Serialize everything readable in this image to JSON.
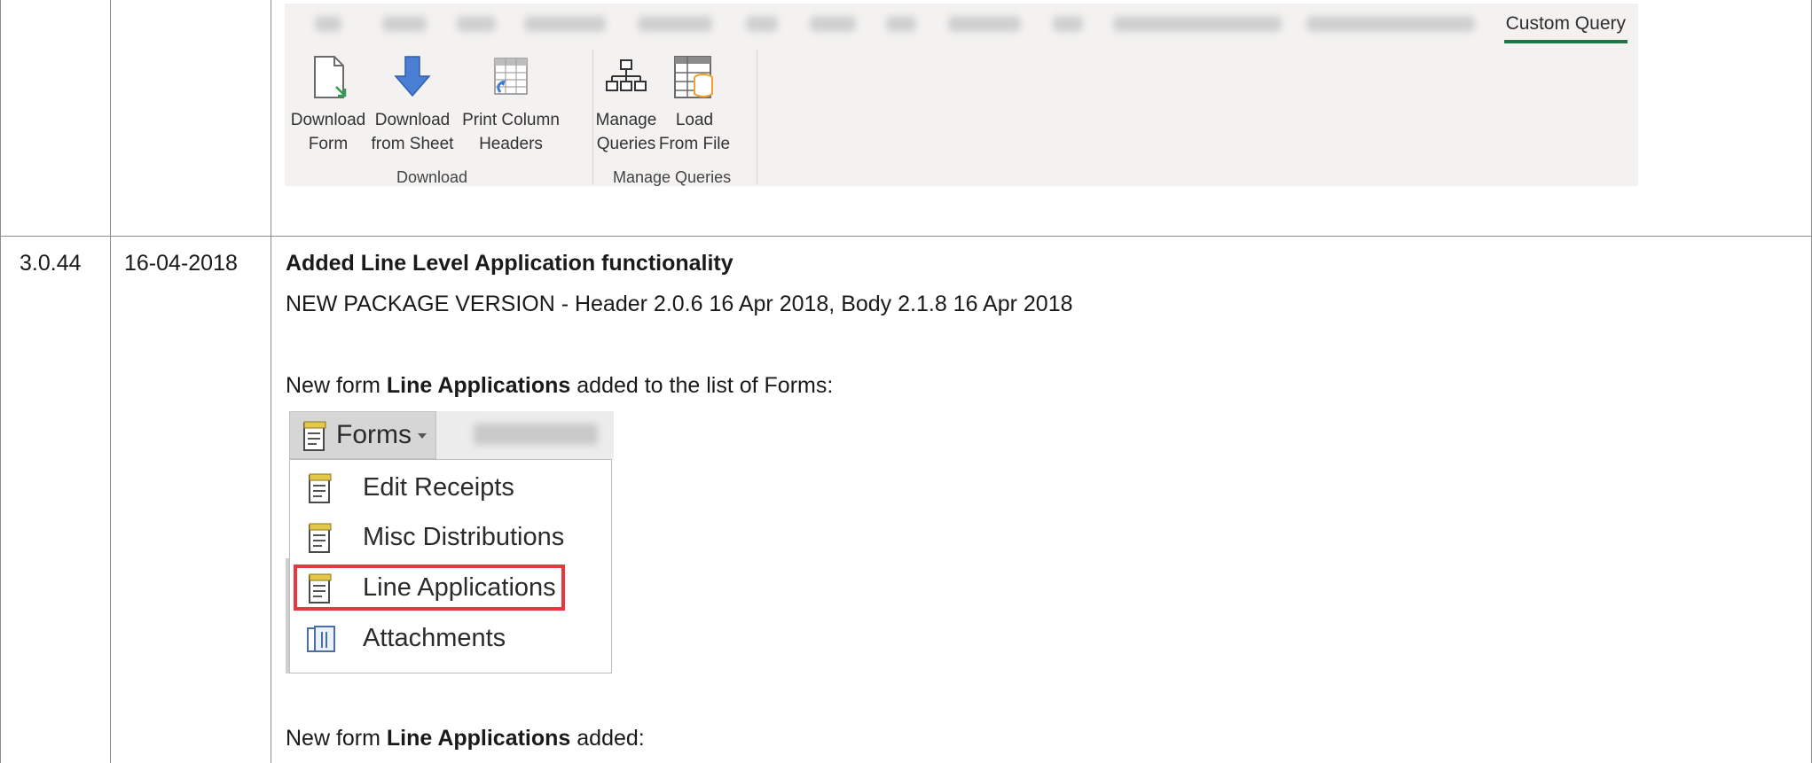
{
  "ribbon": {
    "active_tab": "Custom Query",
    "buttons": [
      {
        "line1": "Download",
        "line2": "Form",
        "icon": "document-arrow-icon"
      },
      {
        "line1": "Download",
        "line2": "from Sheet",
        "icon": "down-arrow-icon"
      },
      {
        "line1": "Print Column",
        "line2": "Headers",
        "icon": "table-headers-icon"
      },
      {
        "line1": "Manage",
        "line2": "Queries",
        "icon": "hierarchy-icon"
      },
      {
        "line1": "Load",
        "line2": "From File",
        "icon": "table-database-icon"
      }
    ],
    "groups": [
      "Download",
      "Manage Queries"
    ]
  },
  "row": {
    "version": "3.0.44",
    "date": "16-04-2018",
    "heading": "Added Line Level Application functionality",
    "package_line": "NEW PACKAGE VERSION - Header 2.0.6 16 Apr 2018, Body 2.1.8 16 Apr 2018",
    "para1_prefix": "New form ",
    "para1_bold": "Line Applications",
    "para1_suffix": " added to the list of Forms:",
    "para2_prefix": "New form ",
    "para2_bold": "Line Applications",
    "para2_suffix": " added:"
  },
  "forms_menu": {
    "button_label": "Forms",
    "items": [
      "Edit Receipts",
      "Misc Distributions",
      "Line Applications",
      "Attachments"
    ],
    "highlighted_item": "Line Applications",
    "highlight_color": "#e8383d"
  },
  "colors": {
    "ribbon_bg": "#f3f2f1",
    "active_tab_underline": "#217346",
    "grid_line": "#8c8c8c"
  }
}
